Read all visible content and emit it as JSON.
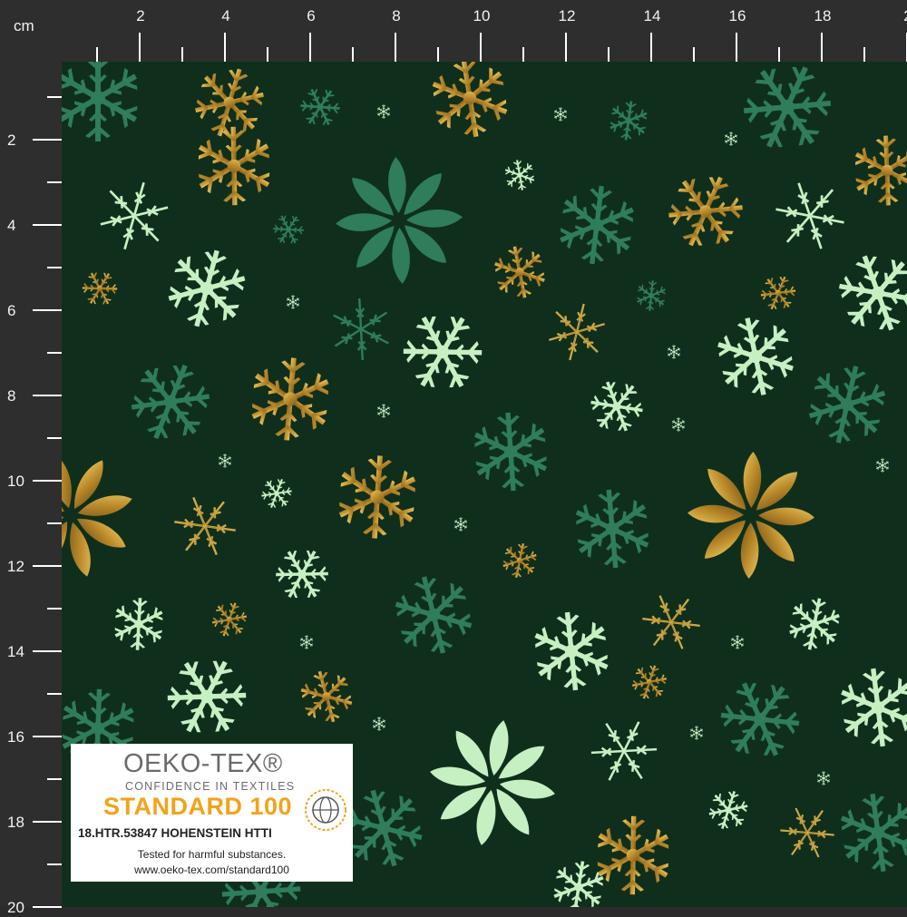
{
  "ruler": {
    "unit": "cm",
    "top_labels": [
      "2",
      "4",
      "6",
      "8",
      "10",
      "12",
      "14",
      "16",
      "18",
      "2"
    ],
    "left_labels": [
      "2",
      "4",
      "6",
      "8",
      "10",
      "12",
      "14",
      "16",
      "18",
      "20"
    ]
  },
  "fabric": {
    "background": "#0f2f1c",
    "colors": {
      "gold": "#c9a23a",
      "gold_dark": "#8a6a1f",
      "mint": "#c6efc2",
      "teal": "#2f7d5a"
    }
  },
  "label": {
    "title": "OEKO-TEX®",
    "subtitle": "CONFIDENCE IN TEXTILES",
    "standard": "STANDARD 100",
    "cert": "18.HTR.53847 HOHENSTEIN HTTI",
    "tested": "Tested for harmful substances.",
    "url": "www.oeko-tex.com/standard100",
    "accent": "#f3a21b",
    "logo_icon": "globe-icon"
  }
}
